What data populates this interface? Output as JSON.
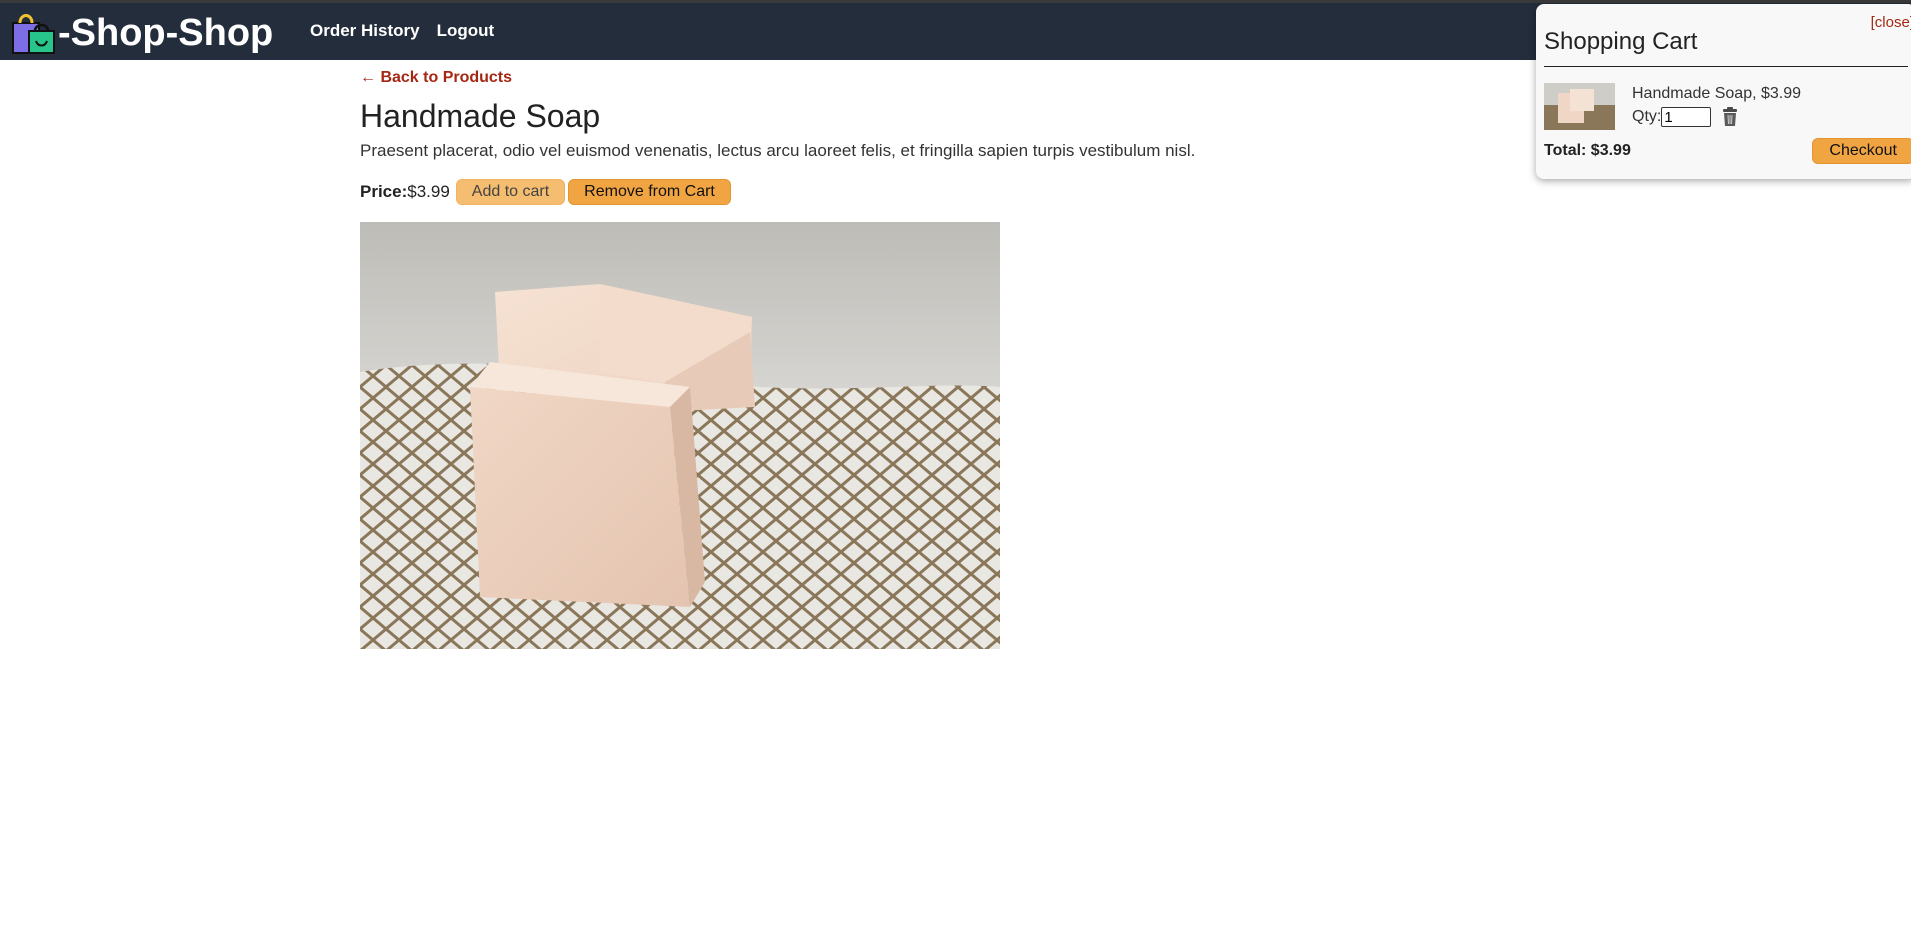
{
  "header": {
    "brand": "-Shop-Shop",
    "nav": [
      "Order History",
      "Logout"
    ]
  },
  "product": {
    "back_link": "← Back to Products",
    "title": "Handmade Soap",
    "description": "Praesent placerat, odio vel euismod venenatis, lectus arcu laoreet felis, et fringilla sapien turpis vestibulum nisl.",
    "price_label": "Price:",
    "price": "$3.99",
    "add_button": "Add to cart",
    "remove_button": "Remove from Cart",
    "image_alt": "Handmade Soap"
  },
  "cart": {
    "close_label": "[close]",
    "title": "Shopping Cart",
    "items": [
      {
        "name_price": "Handmade Soap, $3.99",
        "qty_label": "Qty:",
        "qty": "1"
      }
    ],
    "total": "Total: $3.99",
    "checkout_button": "Checkout"
  },
  "colors": {
    "header_bg": "#232d3c",
    "accent_button": "#f1a542",
    "link_red": "#a52714"
  }
}
